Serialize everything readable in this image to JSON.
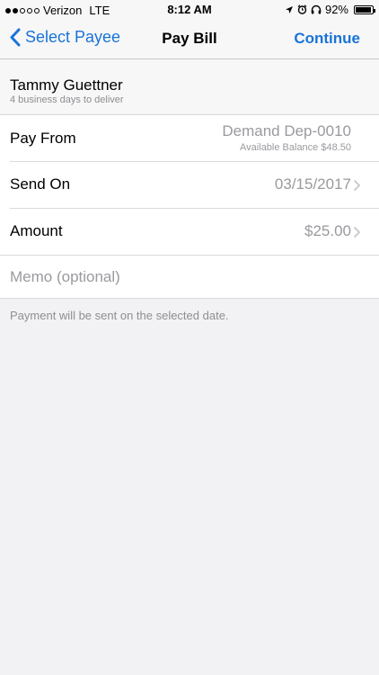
{
  "status_bar": {
    "carrier": "Verizon",
    "network": "LTE",
    "time": "8:12 AM",
    "battery_percent": "92%",
    "battery_level": 0.92,
    "signal_bars_filled": 2,
    "signal_bars_total": 5
  },
  "nav": {
    "back_label": "Select Payee",
    "title": "Pay Bill",
    "continue_label": "Continue"
  },
  "payee": {
    "name": "Tammy Guettner",
    "delivery": "4 business days to deliver"
  },
  "form": {
    "pay_from_label": "Pay From",
    "pay_from_account": "Demand Dep-0010",
    "pay_from_balance": "Available Balance $48.50",
    "send_on_label": "Send On",
    "send_on_value": "03/15/2017",
    "amount_label": "Amount",
    "amount_value": "$25.00",
    "memo_placeholder": "Memo (optional)"
  },
  "note": "Payment will be sent on the selected date.",
  "colors": {
    "accent": "#1a73d9",
    "secondary_text": "#9a9a9f",
    "background": "#f2f2f4"
  }
}
